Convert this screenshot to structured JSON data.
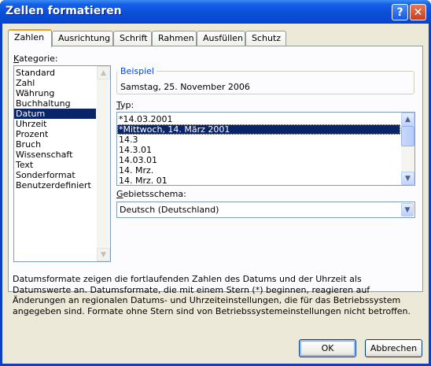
{
  "window": {
    "title": "Zellen formatieren",
    "help_label": "?",
    "close_label": "✕"
  },
  "tabs": [
    {
      "label": "Zahlen",
      "active": true
    },
    {
      "label": "Ausrichtung",
      "active": false
    },
    {
      "label": "Schrift",
      "active": false
    },
    {
      "label": "Rahmen",
      "active": false
    },
    {
      "label": "Ausfüllen",
      "active": false
    },
    {
      "label": "Schutz",
      "active": false
    }
  ],
  "category": {
    "label_first": "K",
    "label_rest": "ategorie:",
    "items": [
      "Standard",
      "Zahl",
      "Währung",
      "Buchhaltung",
      "Datum",
      "Uhrzeit",
      "Prozent",
      "Bruch",
      "Wissenschaft",
      "Text",
      "Sonderformat",
      "Benutzerdefiniert"
    ],
    "selected": "Datum"
  },
  "sample": {
    "title": "Beispiel",
    "value": "Samstag, 25. November 2006"
  },
  "type": {
    "label_first": "T",
    "label_rest": "yp:",
    "items": [
      "*14.03.2001",
      "*Mittwoch, 14. März 2001",
      "14.3",
      "14.3.01",
      "14.03.01",
      "14. Mrz.",
      "14. Mrz. 01"
    ],
    "selected": "*Mittwoch, 14. März 2001"
  },
  "locale": {
    "label_first": "G",
    "label_rest": "ebietsschema:",
    "value": "Deutsch (Deutschland)"
  },
  "description": "Datumsformate zeigen die fortlaufenden Zahlen des Datums und der Uhrzeit als Datumswerte an. Datumsformate, die mit einem Stern (*) beginnen, reagieren auf Änderungen an regionalen Datums- und Uhrzeiteinstellungen, die für das Betriebssystem angegeben sind. Formate ohne Stern sind von Betriebssystemeinstellungen nicht betroffen.",
  "buttons": {
    "ok": "OK",
    "cancel": "Abbrechen"
  },
  "icons": {
    "scroll_up": "▲",
    "scroll_down": "▼",
    "dropdown": "▼"
  },
  "colors": {
    "title_bar": "#0a4fd8",
    "selection": "#0a246a",
    "group_title": "#0046d5",
    "active_tab_accent": "#e6a12d"
  }
}
